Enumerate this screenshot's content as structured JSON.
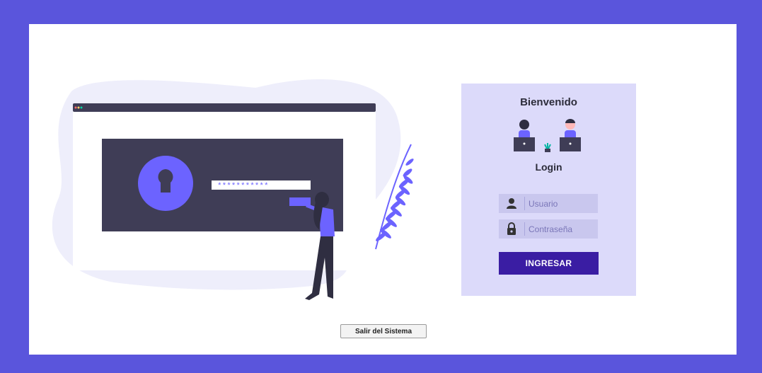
{
  "illustration": {
    "password_mask": "***********"
  },
  "login_panel": {
    "welcome": "Bienvenido",
    "title": "Login",
    "username": {
      "placeholder": "Usuario",
      "value": ""
    },
    "password": {
      "placeholder": "Contraseña",
      "value": ""
    },
    "submit_label": "INGRESAR",
    "icons": [
      "user-icon",
      "lock-icon"
    ]
  },
  "footer": {
    "exit_label": "Salir del Sistema"
  },
  "colors": {
    "background": "#5a55dc",
    "panel": "#dcdafa",
    "field": "#c9c7ee",
    "button": "#3a1da3",
    "accent": "#6c63ff"
  }
}
